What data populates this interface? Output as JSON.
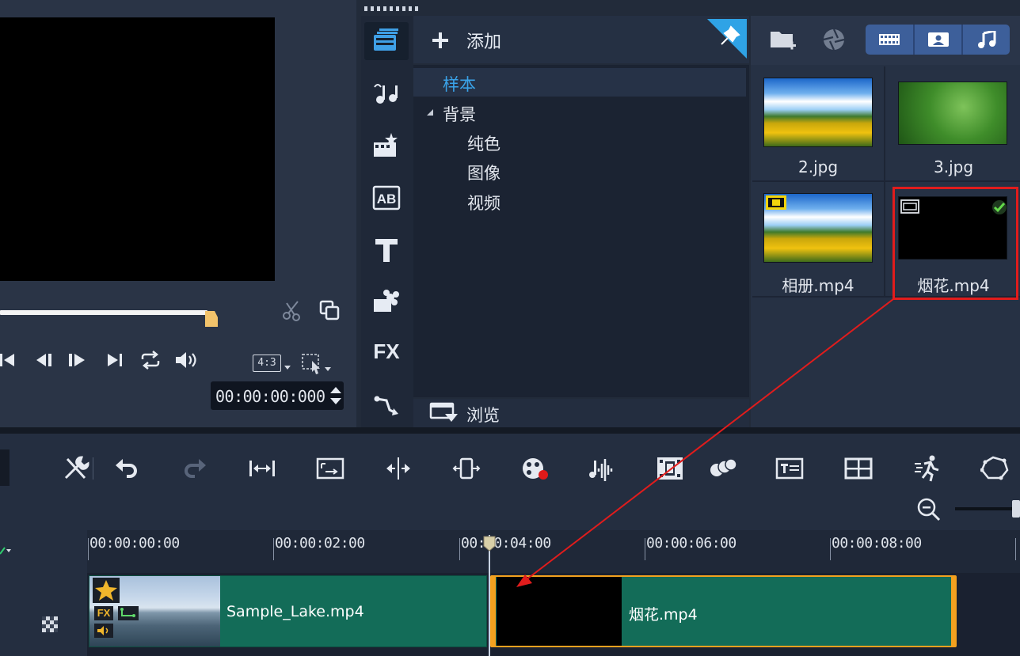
{
  "preview": {
    "timecode": "00:00:00:000",
    "aspect_ratio_label": "4:3"
  },
  "library": {
    "add_label": "添加",
    "browse_label": "浏览",
    "tree": {
      "selected": "样本",
      "group": "背景",
      "children": [
        "纯色",
        "图像",
        "视频"
      ]
    },
    "tools": [
      "media-icon",
      "instant-project-icon",
      "transition-icon",
      "ab-title-icon",
      "text-icon",
      "graphics-icon",
      "fx-icon",
      "path-icon"
    ],
    "fx_label": "FX",
    "thumbnails": [
      {
        "name": "2.jpg",
        "type": "image"
      },
      {
        "name": "3.jpg",
        "type": "image"
      },
      {
        "name": "相册.mp4",
        "type": "video"
      },
      {
        "name": "烟花.mp4",
        "type": "video",
        "checked": true,
        "highlighted": true
      }
    ]
  },
  "timeline": {
    "ruler_labels": [
      "00:00:00:00",
      "00:00:02:00",
      "00:00:04:00",
      "00:00:06:00",
      "00:00:08:00"
    ],
    "clips": [
      {
        "name": "Sample_Lake.mp4",
        "fx_badge": "FX"
      },
      {
        "name": "烟花.mp4",
        "selected": true
      }
    ]
  },
  "colors": {
    "accent_blue": "#3d5f9a",
    "clip_green": "#136c58",
    "clip_selected_border": "#f3a11f",
    "annotation_red": "#e11c1c"
  }
}
